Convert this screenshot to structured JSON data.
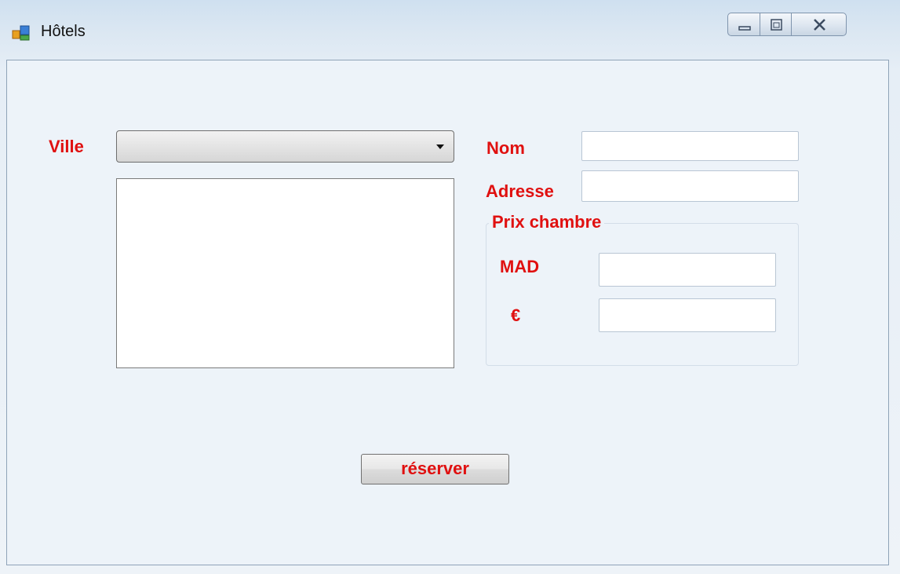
{
  "window": {
    "title": "Hôtels",
    "app_icon": "winforms-app-icon",
    "caption_buttons": {
      "minimize_icon": "minimize-icon",
      "maximize_icon": "maximize-icon",
      "close_icon": "close-icon"
    }
  },
  "form": {
    "ville_label": "Ville",
    "ville_combo": {
      "value": "",
      "icon": "chevron-down-icon"
    },
    "hotels_list": {
      "items": []
    },
    "nom_label": "Nom",
    "nom_value": "",
    "adresse_label": "Adresse",
    "adresse_value": "",
    "prix_group_label": "Prix chambre",
    "mad_label": "MAD",
    "mad_value": "",
    "euro_label": "€",
    "euro_value": "",
    "reserver_label": "réserver"
  },
  "colors": {
    "label_red": "#e01010",
    "client_bg": "#edf3f9"
  }
}
